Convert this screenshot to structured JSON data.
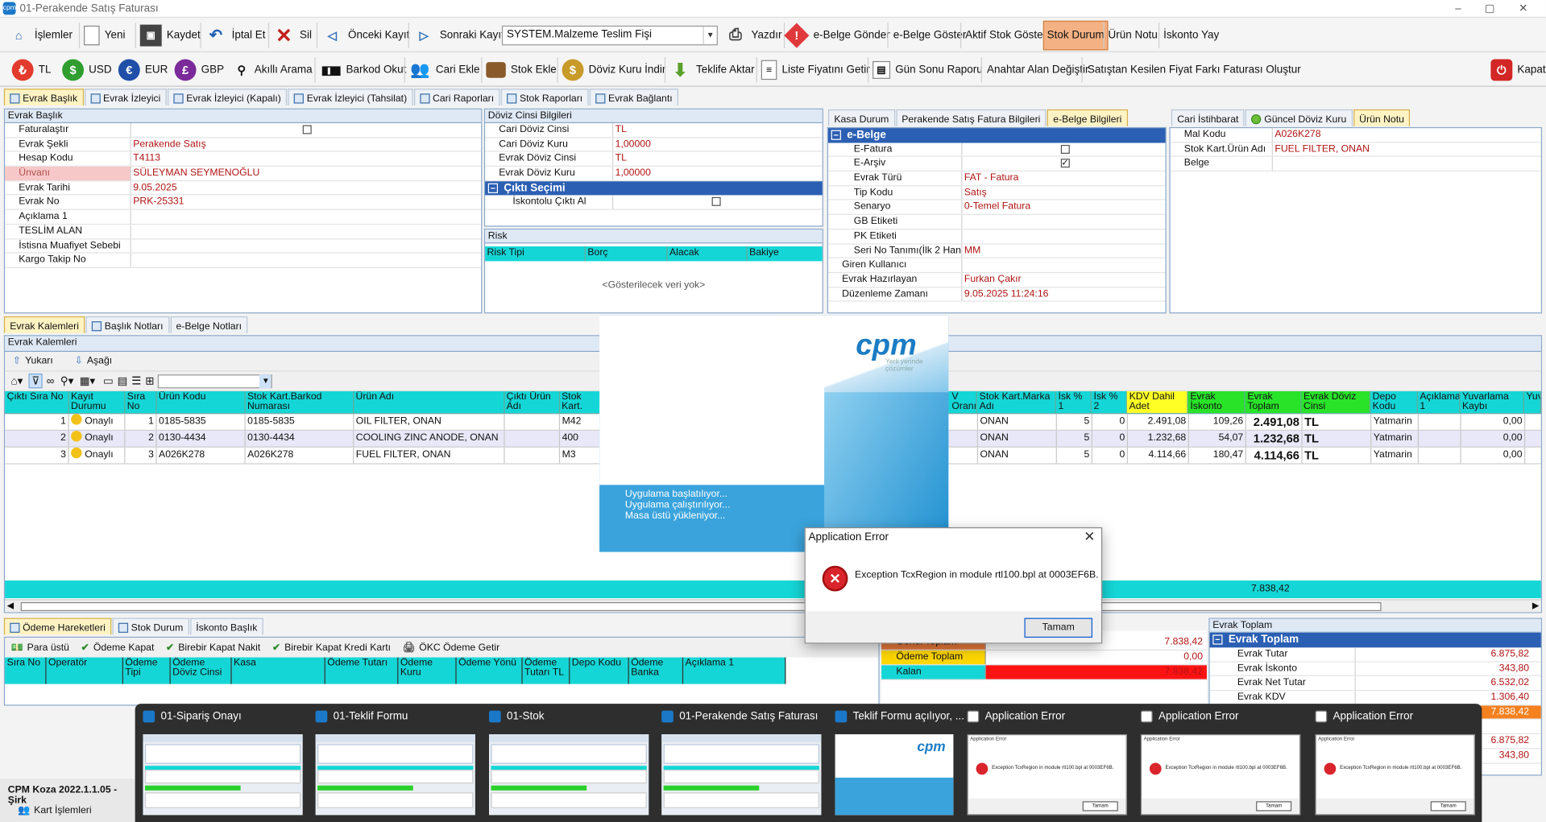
{
  "window": {
    "title": "01-Perakende Satış Faturası",
    "logo": "cpm"
  },
  "toolbar1": [
    {
      "label": "İşlemler",
      "icon": "home-icon"
    },
    {
      "label": "Yeni",
      "icon": "new-document-icon"
    },
    {
      "label": "Kaydet",
      "icon": "save-icon"
    },
    {
      "label": "İptal Et",
      "icon": "undo-icon"
    },
    {
      "label": "Sil",
      "icon": "delete-icon"
    },
    {
      "label": "Önceki Kayıt",
      "icon": "arrow-left-icon"
    },
    {
      "label": "Sonraki Kayıt",
      "icon": "arrow-right-icon"
    },
    {
      "label": "Yazdır",
      "icon": "printer-icon"
    },
    {
      "label": "e-Belge Gönder",
      "icon": "warning-icon"
    },
    {
      "label": "e-Belge Göster"
    },
    {
      "label": "Aktif Stok Göster"
    },
    {
      "label": "Stok Durum"
    },
    {
      "label": "Ürün Notu"
    },
    {
      "label": "İskonto Yay"
    }
  ],
  "doc_type_combo": "SYSTEM.Malzeme Teslim Fişi",
  "toolbar2": [
    {
      "label": "TL",
      "icon": "lira-icon",
      "color": "#e23b2e"
    },
    {
      "label": "USD",
      "icon": "dollar-icon",
      "color": "#2f9e2f"
    },
    {
      "label": "EUR",
      "icon": "euro-icon",
      "color": "#1f4fa8"
    },
    {
      "label": "GBP",
      "icon": "pound-icon",
      "color": "#7b2a9a"
    },
    {
      "label": "Akıllı Arama",
      "icon": "search-icon"
    },
    {
      "label": "Barkod Okut",
      "icon": "barcode-icon"
    },
    {
      "label": "Cari Ekle",
      "icon": "users-icon"
    },
    {
      "label": "Stok Ekle",
      "icon": "box-icon"
    },
    {
      "label": "Döviz Kuru İndir",
      "icon": "coins-icon"
    },
    {
      "label": "Teklife Aktar",
      "icon": "download-arrow-icon"
    },
    {
      "label": "Liste Fiyatını Getir",
      "icon": "list-icon"
    },
    {
      "label": "Gün Sonu Raporu",
      "icon": "report-icon"
    },
    {
      "label": "Anahtar Alan Değiştir"
    },
    {
      "label": "Satıştan Kesilen Fiyat Farkı Faturası Oluştur"
    }
  ],
  "exit_label": "Kapat",
  "top_tabs": [
    "Evrak Başlık",
    "Evrak İzleyici",
    "Evrak İzleyici (Kapalı)",
    "Evrak İzleyici (Tahsilat)",
    "Cari Raporları",
    "Stok Raporları",
    "Evrak Bağlantı"
  ],
  "evrak_baslik": {
    "title": "Evrak Başlık",
    "rows": [
      {
        "k": "Faturalaştır",
        "v": "",
        "cb": true,
        "checked": false
      },
      {
        "k": "Evrak Şekli",
        "v": "Perakende Satış"
      },
      {
        "k": "Hesap Kodu",
        "v": "T4113"
      },
      {
        "k": "Ünvanı",
        "v": "SÜLEYMAN SEYMENOĞLU",
        "hl": true
      },
      {
        "k": "Evrak Tarihi",
        "v": "9.05.2025"
      },
      {
        "k": "Evrak No",
        "v": "PRK-25331"
      },
      {
        "k": "Açıklama 1",
        "v": ""
      },
      {
        "k": "TESLİM ALAN",
        "v": ""
      },
      {
        "k": "İstisna Muafiyet Sebebi",
        "v": ""
      },
      {
        "k": "Kargo Takip No",
        "v": ""
      }
    ]
  },
  "doviz": {
    "title": "Döviz Cinsi Bilgileri",
    "rows": [
      {
        "k": "Cari Döviz Cinsi",
        "v": "TL"
      },
      {
        "k": "Cari Döviz Kuru",
        "v": "1,00000"
      },
      {
        "k": "Evrak Döviz Cinsi",
        "v": "TL"
      },
      {
        "k": "Evrak Döviz Kuru",
        "v": "1,00000"
      }
    ],
    "cikti_title": "Çıktı Seçimi",
    "cikti_row": "İskontolu Çıktı Al"
  },
  "risk": {
    "title": "Risk",
    "cols": [
      "Risk Tipi",
      "Borç",
      "Alacak",
      "Bakiye"
    ],
    "empty": "<Gösterilecek veri yok>"
  },
  "mid_tabs": [
    "Kasa Durum",
    "Perakende Satış Fatura Bilgileri",
    "e-Belge Bilgileri"
  ],
  "ebelge": {
    "cat": "e-Belge",
    "rows": [
      {
        "k": "E-Fatura",
        "v": "",
        "cb": true,
        "checked": false
      },
      {
        "k": "E-Arşiv",
        "v": "",
        "cb": true,
        "checked": true
      },
      {
        "k": "Evrak Türü",
        "v": "FAT - Fatura"
      },
      {
        "k": "Tip Kodu",
        "v": "Satış"
      },
      {
        "k": "Senaryo",
        "v": "0-Temel Fatura"
      },
      {
        "k": "GB Etiketi",
        "v": ""
      },
      {
        "k": "PK Etiketi",
        "v": ""
      },
      {
        "k": "Seri No Tanımı(İlk 2 Hane)",
        "v": "MM"
      }
    ],
    "rows2": [
      {
        "k": "Giren Kullanıcı",
        "v": ""
      },
      {
        "k": "Evrak Hazırlayan",
        "v": "Furkan Çakır"
      },
      {
        "k": "Düzenleme Zamanı",
        "v": "9.05.2025 11:24:16"
      }
    ]
  },
  "right_tabs": [
    "Cari İstihbarat",
    "Güncel Döviz Kuru",
    "Ürün Notu"
  ],
  "urun_notu": {
    "rows": [
      {
        "k": "Mal Kodu",
        "v": "A026K278"
      },
      {
        "k": "Stok Kart.Ürün Adı",
        "v": "FUEL FILTER, ONAN"
      },
      {
        "k": "Belge",
        "v": ""
      }
    ]
  },
  "lower_tabs": [
    "Evrak Kalemleri",
    "Başlık Notları",
    "e-Belge Notları"
  ],
  "kalemler": {
    "title": "Evrak Kalemleri",
    "up": "Yukarı",
    "down": "Aşağı",
    "cols": [
      "Çıktı Sıra No",
      "Kayıt Durumu",
      "Sıra No",
      "Ürün Kodu",
      "Stok Kart.Barkod Numarası",
      "Ürün Adı",
      "Çıktı Ürün Adı",
      "Stok Kart."
    ],
    "cols2": [
      "V Oranı",
      "Stok Kart.Marka Adı",
      "İsk % 1",
      "İsk % 2",
      "KDV Dahil Adet",
      "Evrak İskonto",
      "Evrak Toplam",
      "Evrak Döviz Cinsi",
      "Depo Kodu",
      "Açıklama 1",
      "Yuvarlama Kaybı",
      "Yuv"
    ],
    "rows": [
      {
        "c1": "1",
        "d": "Onaylı",
        "s": "1",
        "kod": "0185-5835",
        "bar": "0185-5835",
        "ad": "OIL FILTER, ONAN",
        "sk": "M42",
        "marka": "ONAN",
        "i1": "5",
        "i2": "0",
        "kdv": "2.491,08",
        "isk": "109,26",
        "top": "2.491,08",
        "dov": "TL",
        "depo": "Yatmarin",
        "yk": "0,00"
      },
      {
        "c1": "2",
        "d": "Onaylı",
        "s": "2",
        "kod": "0130-4434",
        "bar": "0130-4434",
        "ad": "COOLING ZINC ANODE, ONAN",
        "sk": "400",
        "marka": "ONAN",
        "i1": "5",
        "i2": "0",
        "kdv": "1.232,68",
        "isk": "54,07",
        "top": "1.232,68",
        "dov": "TL",
        "depo": "Yatmarin",
        "yk": "0,00"
      },
      {
        "c1": "3",
        "d": "Onaylı",
        "s": "3",
        "kod": "A026K278",
        "bar": "A026K278",
        "ad": "FUEL FILTER, ONAN",
        "sk": "M3",
        "marka": "ONAN",
        "i1": "5",
        "i2": "0",
        "kdv": "4.114,66",
        "isk": "180,47",
        "top": "4.114,66",
        "dov": "TL",
        "depo": "Yatmarin",
        "yk": "0,00"
      }
    ],
    "footer_total": "7.838,42"
  },
  "splash": {
    "brand": "cpm",
    "tagline": "Yerli yerinde çözümler",
    "lines": [
      "Uygulama başlatılıyor...",
      "Uygulama çalıştırılıyor...",
      "Masa üstü yükleniyor..."
    ]
  },
  "error_dialog": {
    "title": "Application Error",
    "message": "Exception TcxRegion in module rtl100.bpl at 0003EF6B.",
    "ok": "Tamam"
  },
  "bottom_tabs": [
    "Ödeme Hareketleri",
    "Stok Durum",
    "İskonto Başlık"
  ],
  "odeme": {
    "actions": [
      "Para üstü",
      "Ödeme Kapat",
      "Birebir Kapat Nakit",
      "Birebir Kapat Kredi Kartı",
      "ÖKC Ödeme Getir"
    ],
    "cols": [
      "Sıra No",
      "Operatör",
      "Ödeme Tipi",
      "Ödeme Döviz Cinsi",
      "Kasa",
      "Ödeme Tutarı",
      "Ödeme Kuru",
      "Ödeme Yönü",
      "Ödeme Tutarı TL",
      "Depo Kodu",
      "Ödeme Banka",
      "Açıklama 1"
    ]
  },
  "odeme_ozet": [
    {
      "k": "Genel Toplam",
      "v": "7.838,42"
    },
    {
      "k": "Ödeme Toplam",
      "v": "0,00"
    },
    {
      "k": "Kalan",
      "v": "7.838,42"
    }
  ],
  "evrak_toplam": {
    "title": "Evrak Toplam",
    "cat": "Evrak Toplam",
    "rows": [
      {
        "k": "Evrak Tutar",
        "v": "6.875,82"
      },
      {
        "k": "Evrak İskonto",
        "v": "343,80"
      },
      {
        "k": "Evrak Net Tutar",
        "v": "6.532,02"
      },
      {
        "k": "Evrak KDV",
        "v": "1.306,40"
      },
      {
        "k": "Evrak Toplam",
        "v": "7.838,42"
      },
      {
        "k": "",
        "v": ""
      },
      {
        "k": "",
        "v": "6.875,82"
      },
      {
        "k": "",
        "v": "343,80"
      }
    ]
  },
  "status": {
    "app": "CPM Koza 2022.1.1.05 - Şirk",
    "kart": "Kart İşlemleri"
  },
  "taskbar_thumbs": [
    {
      "label": "01-Sipariş Onayı",
      "kind": "app"
    },
    {
      "label": "01-Teklif Formu",
      "kind": "app"
    },
    {
      "label": "01-Stok",
      "kind": "app"
    },
    {
      "label": "01-Perakende Satış Faturası",
      "kind": "app"
    },
    {
      "label": "Teklif Formu açılıyor, ...",
      "kind": "splash"
    },
    {
      "label": "Application Error",
      "kind": "error"
    },
    {
      "label": "Application Error",
      "kind": "error"
    },
    {
      "label": "Application Error",
      "kind": "error"
    }
  ],
  "thumb_error": {
    "title": "Application Error",
    "message": "Exception TcxRegion in module rtl100.bpl at 0003EF6B.",
    "ok": "Tamam"
  }
}
